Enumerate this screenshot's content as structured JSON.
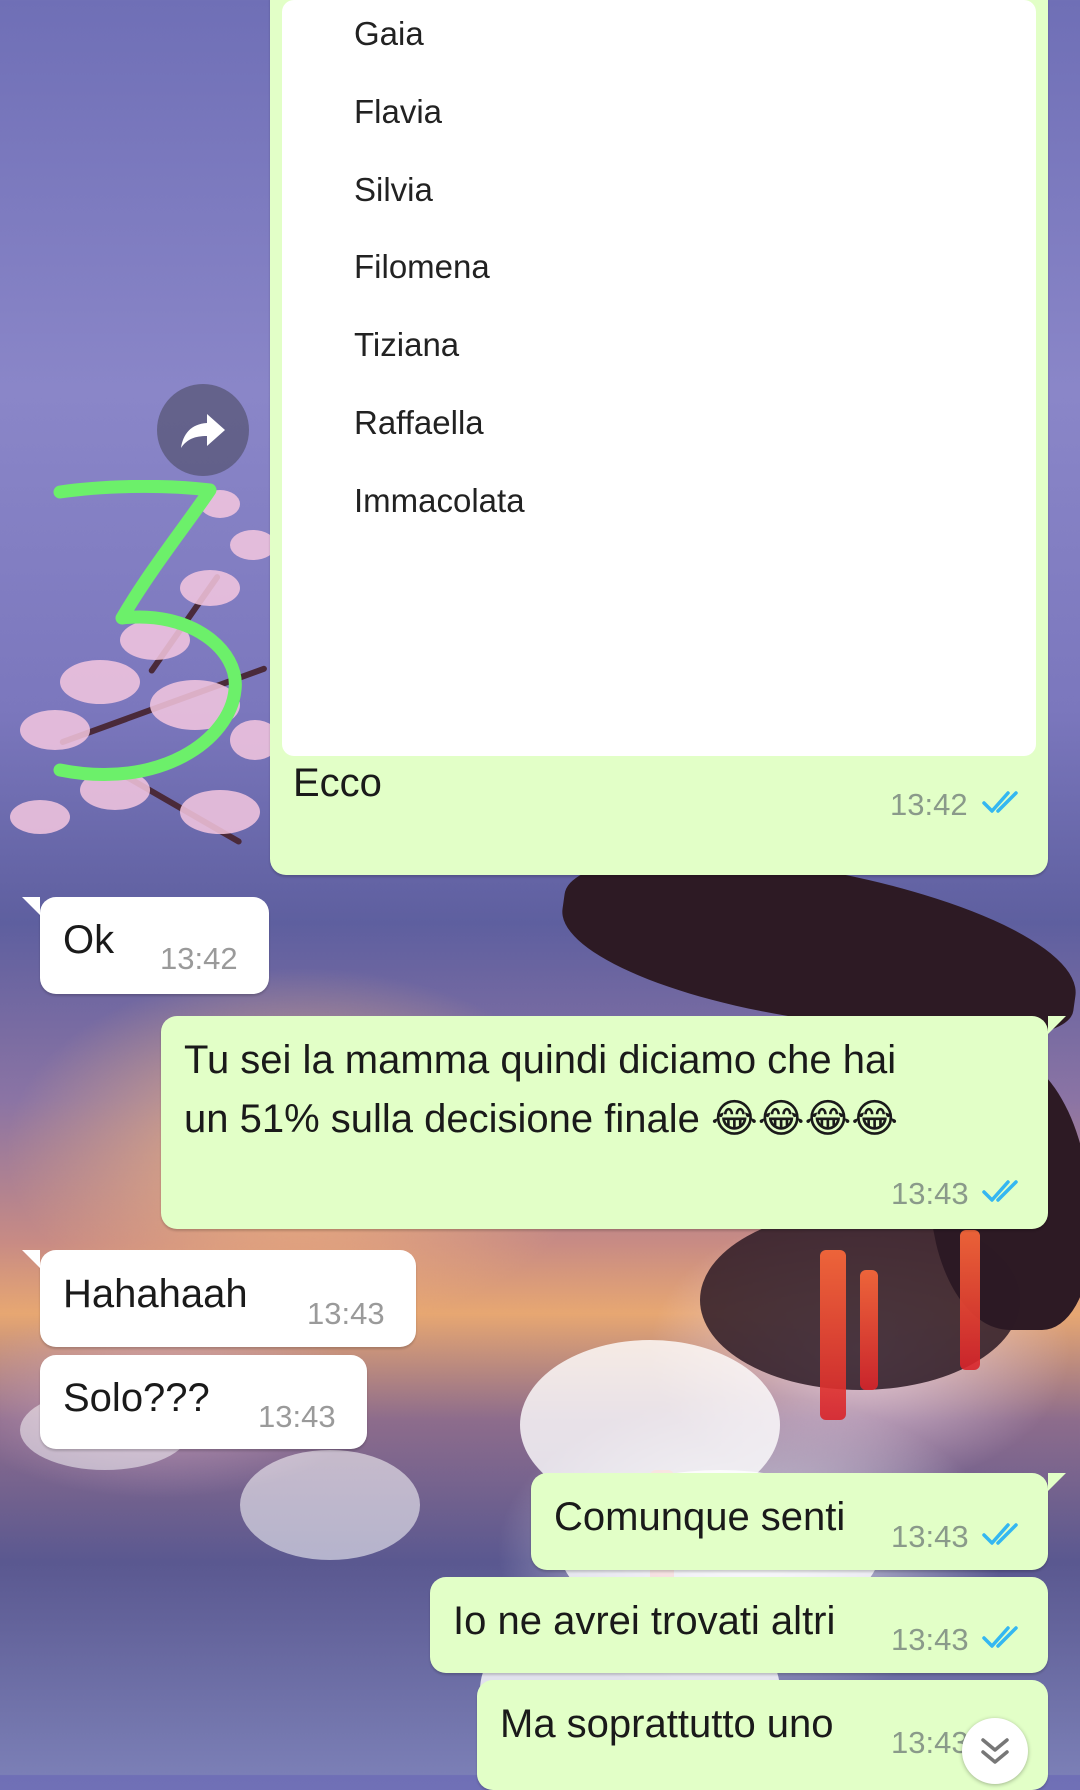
{
  "document": {
    "names": [
      "Gaia",
      "Flavia",
      "Silvia",
      "Filomena",
      "Tiziana",
      "Raffaella",
      "Immacolata"
    ],
    "caption": "Ecco",
    "time": "13:42"
  },
  "messages": [
    {
      "direction": "in",
      "text": "Ok",
      "time": "13:42"
    },
    {
      "direction": "out",
      "line1": "Tu sei la mamma quindi diciamo che hai",
      "line2": "un 51% sulla decisione finale",
      "emoji": "😂😂😂😂",
      "time": "13:43"
    },
    {
      "direction": "in",
      "text": "Hahahaah",
      "time": "13:43"
    },
    {
      "direction": "in",
      "text": "Solo???",
      "time": "13:43"
    },
    {
      "direction": "out",
      "text": "Comunque senti",
      "time": "13:43"
    },
    {
      "direction": "out",
      "text": "Io ne avrei trovati altri",
      "time": "13:43"
    },
    {
      "direction": "out",
      "text": "Ma soprattutto uno",
      "time": "13:43"
    }
  ],
  "icons": {
    "forward": "forward-arrow-icon",
    "read": "double-check-icon",
    "scroll": "chevron-double-down-icon"
  },
  "colors": {
    "outgoing_bubble": "#e2ffc7",
    "incoming_bubble": "#ffffff",
    "read_ticks": "#34b7f1",
    "annotation": "#6cf06a"
  }
}
